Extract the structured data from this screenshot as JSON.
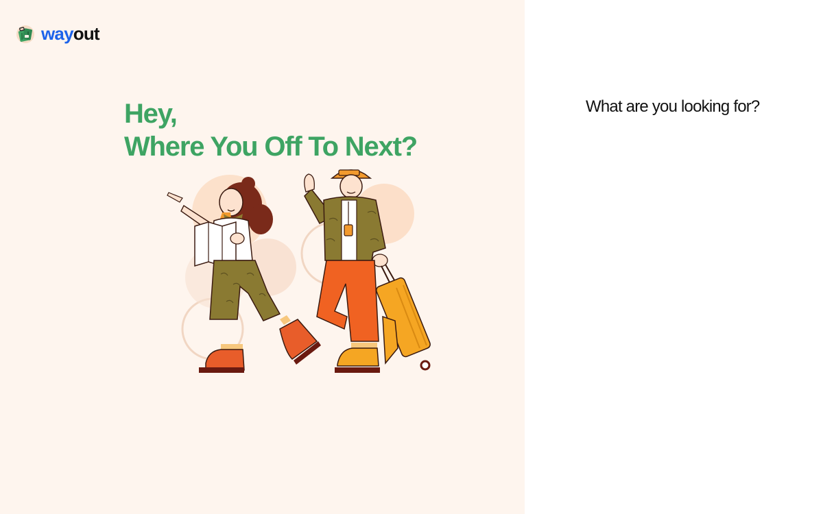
{
  "brand": {
    "name_part1": "way",
    "name_part2": "out",
    "colors": {
      "way": "#1d63ea",
      "out": "#111111",
      "headline": "#3ea463",
      "panel_bg": "#fef5ee"
    }
  },
  "hero": {
    "line1": "Hey,",
    "line2": "Where You Off To Next?"
  },
  "question": {
    "title": "What are you looking for?"
  },
  "icons": {
    "logo": "suitcase-logo-icon",
    "illustration": "travelers-illustration"
  }
}
